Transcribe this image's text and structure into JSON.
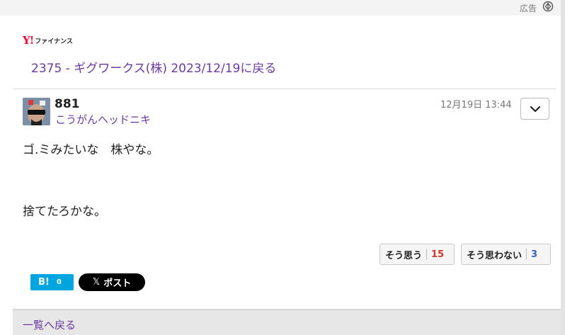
{
  "ad": {
    "label": "広告",
    "icon": "adchoices-icon"
  },
  "logo": {
    "mark": "Y!",
    "text": "ファイナンス"
  },
  "nav": {
    "back_to_stock": "2375 - ギグワークス(株) 2023/12/19に戻る"
  },
  "post": {
    "number": "881",
    "username": "こうがんヘッドニキ",
    "timestamp": "12月19日 13:44",
    "menu_icon": "chevron-down-icon",
    "body_line1": "ゴ.ミみたいな　株やな。",
    "body_line2": "捨てたろかな。"
  },
  "votes": {
    "agree_label": "そう思う",
    "agree_count": "15",
    "disagree_label": "そう思わない",
    "disagree_count": "3"
  },
  "share": {
    "hatena_label": "B!",
    "hatena_count": "0",
    "x_icon": "𝕏",
    "x_label": "ポスト"
  },
  "footer": {
    "back_to_list": "一覧へ戻る"
  },
  "colors": {
    "link": "#6b3aa0",
    "agree": "#d0352b",
    "disagree": "#3b5fc0",
    "hatena": "#00a4de"
  }
}
